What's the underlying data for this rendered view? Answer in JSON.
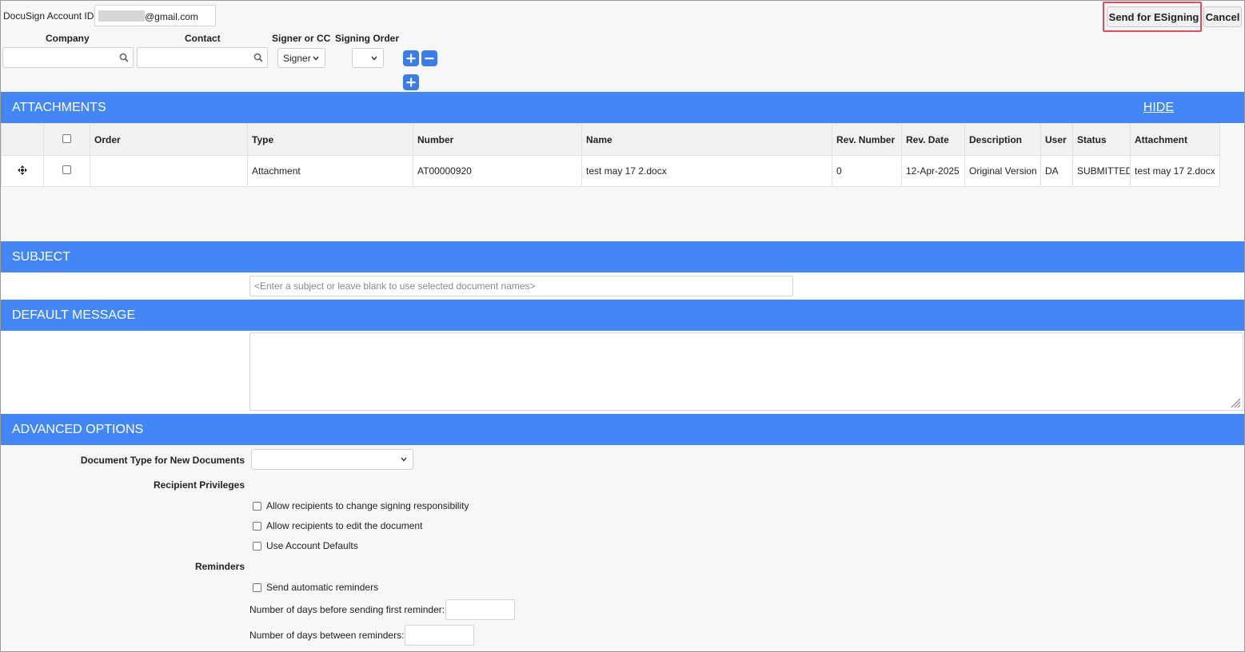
{
  "header": {
    "account_label": "DocuSign Account ID",
    "account_value": "@gmail.com",
    "send_button": "Send for ESigning",
    "cancel_button": "Cancel"
  },
  "recipient": {
    "company_label": "Company",
    "contact_label": "Contact",
    "signer_label": "Signer or CC",
    "order_label": "Signing Order",
    "signer_value": "Signer",
    "order_value": ""
  },
  "attachments": {
    "title": "ATTACHMENTS",
    "hide_link": "HIDE",
    "columns": [
      "Order",
      "Type",
      "Number",
      "Name",
      "Rev. Number",
      "Rev. Date",
      "Description",
      "User",
      "Status",
      "Attachment"
    ],
    "rows": [
      {
        "order": "",
        "type": "Attachment",
        "number": "AT00000920",
        "name": "test may 17 2.docx",
        "rev_number": "0",
        "rev_date": "12-Apr-2025",
        "description": "Original Version",
        "user": "DA",
        "status": "SUBMITTED",
        "attachment": "test may 17 2.docx"
      }
    ]
  },
  "subject": {
    "title": "SUBJECT",
    "placeholder": "<Enter a subject or leave blank to use selected document names>"
  },
  "message": {
    "title": "DEFAULT MESSAGE"
  },
  "advanced": {
    "title": "ADVANCED OPTIONS",
    "doc_type_label": "Document Type for New Documents",
    "doc_type_value": "",
    "privileges_label": "Recipient Privileges",
    "opt_change_signing": "Allow recipients to change signing responsibility",
    "opt_edit_doc": "Allow recipients to edit the document",
    "opt_account_defaults": "Use Account Defaults",
    "reminders_label": "Reminders",
    "opt_auto_reminders": "Send automatic reminders",
    "first_reminder_label": "Number of days before sending first reminder:",
    "between_reminders_label": "Number of days between reminders:"
  },
  "icons": {
    "search": "search-icon",
    "add": "plus-icon",
    "remove": "minus-icon",
    "move": "move-handle-icon"
  },
  "colors": {
    "section_bar": "#4287f5",
    "highlight": "#e24b5a"
  }
}
